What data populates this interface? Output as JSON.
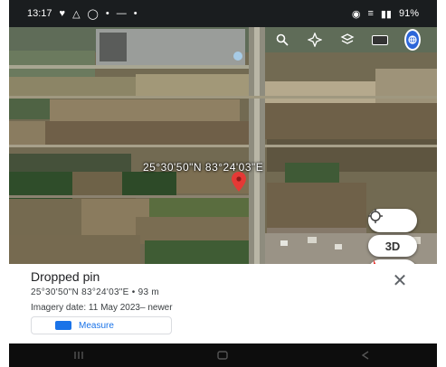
{
  "status_bar": {
    "time": "13:17",
    "left_icons": [
      "notification-icon",
      "alert-icon",
      "whatsapp-icon",
      "email-icon",
      "more-icon"
    ],
    "right_icons": [
      "wifi-icon",
      "volte-icon",
      "signal-icon"
    ],
    "battery": "91%"
  },
  "toolbar": {
    "icons": [
      "search-icon",
      "voyager-icon",
      "layers-icon",
      "measure-icon",
      "globe-icon"
    ]
  },
  "map": {
    "pin_label": "25°30'50\"N 83°24'03\"E",
    "controls": {
      "locate": "locate-icon",
      "threed_label": "3D",
      "compass": "compass-icon"
    }
  },
  "sheet": {
    "title": "Dropped pin",
    "coords": "25°30'50\"N 83°24'03\"E • 93 m",
    "imagery": "Imagery date: 11 May 2023– newer",
    "measure_label": "Measure",
    "close_icon": "close-icon"
  },
  "navbar": {
    "icons": [
      "recents-icon",
      "home-icon",
      "back-icon"
    ]
  },
  "colors": {
    "accent": "#1a73e8",
    "pin": "#e53935",
    "globe": "#2c66d9"
  }
}
